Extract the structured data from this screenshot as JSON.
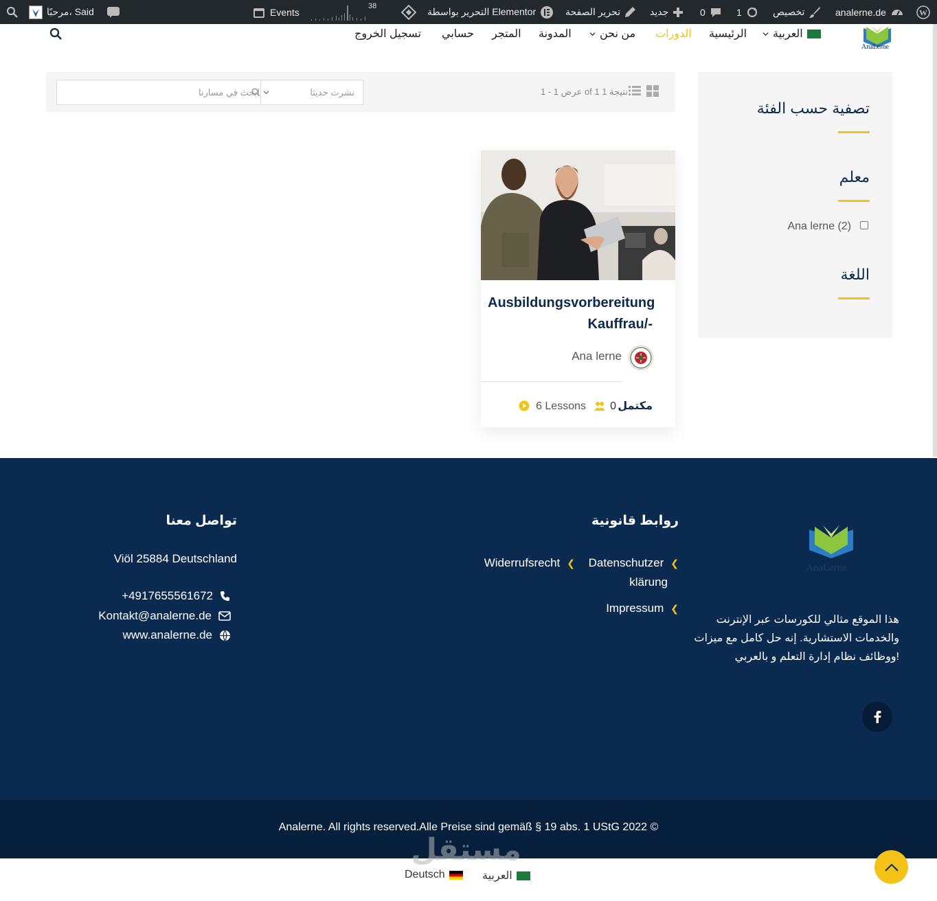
{
  "adminbar": {
    "site_name": "analerne.de",
    "customize": "تخصيص",
    "updates_count": "1",
    "comments_count": "0",
    "new_label": "جديد",
    "edit_page": "تحرير الصفحة",
    "elementor": "التحرير بواسطة Elementor",
    "events": "Events",
    "stats_count": "38",
    "greeting": "مرحبًا، Said"
  },
  "nav": {
    "language": "العربية",
    "home": "الرئيسية",
    "courses": "الدورات",
    "about": "من نحن",
    "blog": "المدونة",
    "shop": "المتجر",
    "account": "حسابي",
    "logout": "تسجيل الخروج",
    "logo_text": "AnaLerne"
  },
  "filter": {
    "result_text": "عرض 1 - 1 of 1 1 نتيجة",
    "sort_value": "نشرت حديثا",
    "search_placeholder": "ابحث في مسارنا"
  },
  "sidebar": {
    "title": "تصفية حسب الفئة",
    "instructor_heading": "معلم",
    "instructor_option": "Ana lerne",
    "instructor_count": "(2)",
    "language_heading": "اللغة"
  },
  "course": {
    "title": "Ausbildungsvorbereitung Kauffrau/-",
    "author": "Ana lerne",
    "completed_label": "مكتمل",
    "students": "0",
    "lessons": "6 Lessons"
  },
  "footer": {
    "logo_text": "AnaLerne",
    "about": "هذا الموقع مثالي للكورسات عبر الإنترنت والخدمات الاستشارية. إنه حل كامل مع ميزات ووظائف نظام إدارة التعلم و بالعربي!",
    "legal_heading": "روابط قانونية",
    "link_privacy_1": "Datenschutzer",
    "link_privacy_2": "klärung",
    "link_withdrawal": "Widerrufsrecht",
    "link_impressum": "Impressum",
    "contact_heading": "تواصل معنا",
    "address": "Viöl 25884 Deutschland",
    "phone": "+4917655561672",
    "email": "Kontakt@analerne.de",
    "website": "www.analerne.de",
    "copyright": "Analerne. All rights reserved.Alle Preise sind gemäß § 19 abs. 1 UStG 2022 ©"
  },
  "language_switcher": {
    "arabic": "العربية",
    "german": "Deutsch"
  },
  "watermark": "مستقل",
  "colors": {
    "accent": "#f3c318",
    "navy": "#0a2a4f",
    "adminbar": "#23282d"
  }
}
